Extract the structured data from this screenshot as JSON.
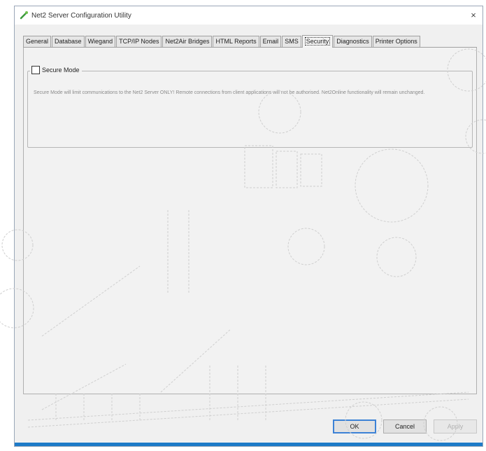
{
  "window": {
    "title": "Net2 Server Configuration Utility",
    "close_glyph": "×"
  },
  "tabs": [
    {
      "label": "General",
      "active": false
    },
    {
      "label": "Database",
      "active": false
    },
    {
      "label": "Wiegand",
      "active": false
    },
    {
      "label": "TCP/IP Nodes",
      "active": false
    },
    {
      "label": "Net2Air Bridges",
      "active": false
    },
    {
      "label": "HTML Reports",
      "active": false
    },
    {
      "label": "Email",
      "active": false
    },
    {
      "label": "SMS",
      "active": false
    },
    {
      "label": "Security",
      "active": true
    },
    {
      "label": "Diagnostics",
      "active": false
    },
    {
      "label": "Printer Options",
      "active": false
    }
  ],
  "security": {
    "secure_mode_label": "Secure Mode",
    "secure_mode_checked": false,
    "description": "Secure Mode will limit communications to the Net2 Server ONLY! Remote connections from client applications will not be authorised. Net2Online functionality will remain unchanged."
  },
  "buttons": {
    "ok": "OK",
    "cancel": "Cancel",
    "apply": "Apply"
  },
  "colors": {
    "accent": "#1e7bc8",
    "window_bg": "#f0f0f0",
    "default_button_border": "#3c82d6"
  },
  "icons": {
    "app": "net2-app-icon",
    "close": "close-icon"
  }
}
